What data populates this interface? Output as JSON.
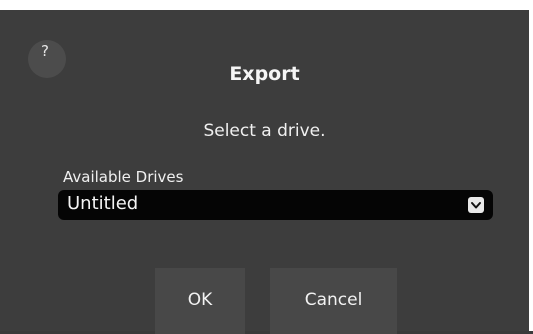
{
  "dialog": {
    "help_label": "?",
    "title": "Export",
    "message": "Select a drive.",
    "drives": {
      "label": "Available Drives",
      "selected": "Untitled"
    },
    "buttons": {
      "ok": "OK",
      "cancel": "Cancel"
    }
  },
  "icons": {
    "help": "question-icon",
    "dropdown": "chevron-down-icon"
  }
}
